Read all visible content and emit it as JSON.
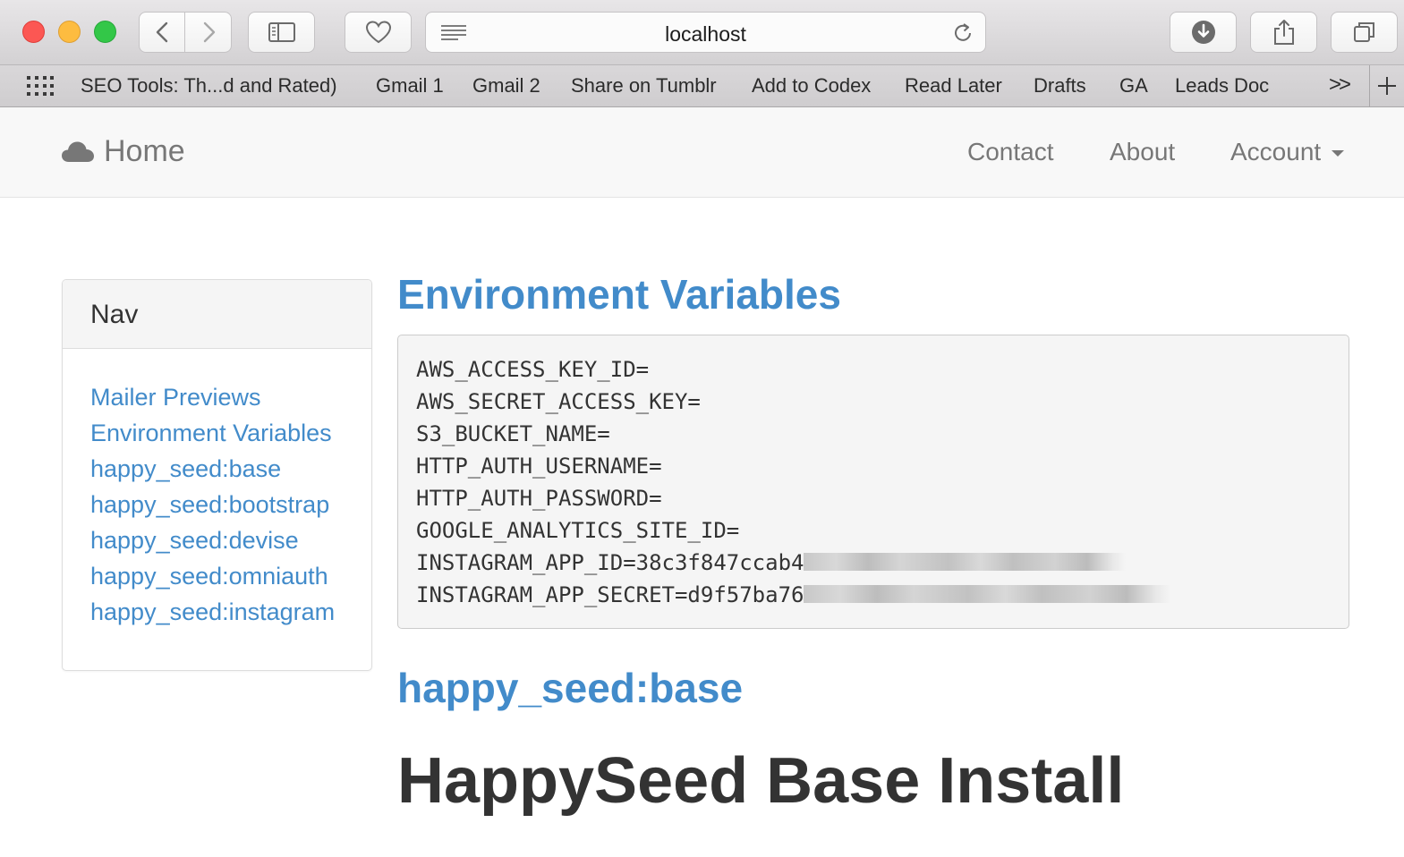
{
  "browser": {
    "url": "localhost",
    "bookmarks": [
      "SEO Tools: Th...d and Rated)",
      "Gmail 1",
      "Gmail 2",
      "Share on Tumblr",
      "Add to Codex",
      "Read Later",
      "Drafts",
      "GA",
      "Leads Doc"
    ],
    "bookmarks_more": ">>"
  },
  "navbar": {
    "brand": "Home",
    "links": [
      "Contact",
      "About",
      "Account"
    ]
  },
  "sidebar": {
    "heading": "Nav",
    "items": [
      "Mailer Previews",
      "Environment Variables",
      "happy_seed:base",
      "happy_seed:bootstrap",
      "happy_seed:devise",
      "happy_seed:omniauth",
      "happy_seed:instagram"
    ]
  },
  "main": {
    "env_heading": "Environment Variables",
    "env_lines": [
      "AWS_ACCESS_KEY_ID=",
      "AWS_SECRET_ACCESS_KEY=",
      "S3_BUCKET_NAME=",
      "HTTP_AUTH_USERNAME=",
      "HTTP_AUTH_PASSWORD=",
      "GOOGLE_ANALYTICS_SITE_ID=",
      "INSTAGRAM_APP_ID=38c3f847ccab4",
      "INSTAGRAM_APP_SECRET=d9f57ba76"
    ],
    "base_heading": "happy_seed:base",
    "install_heading": "HappySeed Base Install"
  }
}
